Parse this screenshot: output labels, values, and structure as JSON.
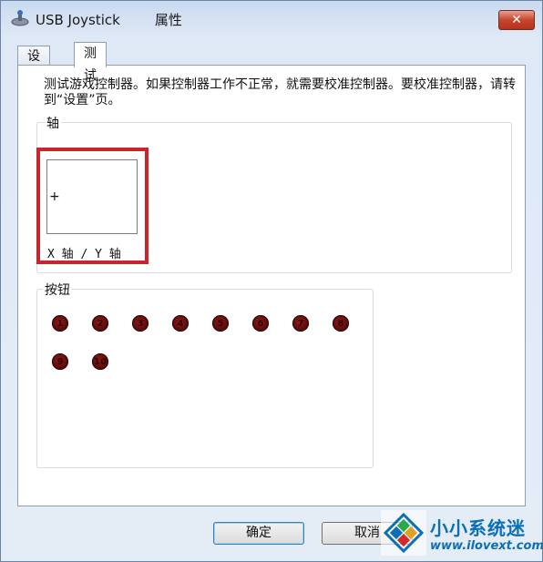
{
  "window": {
    "title": "USB Joystick",
    "title_suffix": "属性",
    "close_label": "✕"
  },
  "tabs": [
    {
      "label": "设置",
      "active": false
    },
    {
      "label": "测试",
      "active": true
    }
  ],
  "panel": {
    "description": "测试游戏控制器。如果控制器工作不正常，就需要校准控制器。要校准控制器，请转到“设置”页。",
    "axis_group": {
      "label": "轴",
      "crosshair": "+",
      "xy_label": "X 轴 / Y 轴"
    },
    "button_group": {
      "label": "按钮",
      "buttons": [
        "1",
        "2",
        "3",
        "4",
        "5",
        "6",
        "7",
        "8",
        "9",
        "10"
      ]
    }
  },
  "footer": {
    "ok_label": "确定",
    "cancel_label": "取消"
  },
  "watermark": {
    "title": "小小系统迷",
    "url": "www.ilovext.com"
  },
  "colors": {
    "highlight": "#c8262c",
    "button_dot": "#6b0f0c",
    "watermark_blue": "#0a6fb6"
  }
}
